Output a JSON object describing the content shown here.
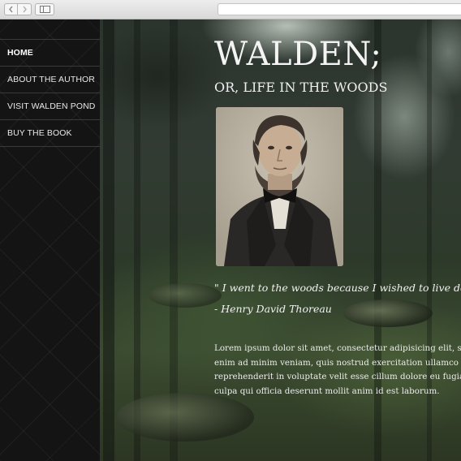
{
  "sidebar": {
    "items": [
      {
        "label": "HOME"
      },
      {
        "label": "ABOUT THE AUTHOR"
      },
      {
        "label": "VISIT WALDEN POND"
      },
      {
        "label": "BUY THE BOOK"
      }
    ]
  },
  "main": {
    "title": "WALDEN;",
    "subtitle": "OR, LIFE IN THE WOODS",
    "quote": "\" I went to the woods because I wished to live delibera",
    "attribution": "- Henry David Thoreau",
    "body_lines": [
      "Lorem ipsum dolor sit amet, consectetur adipisicing elit, sed do eius",
      "enim ad minim veniam, quis nostrud exercitation ullamco laboris nis",
      "reprehenderit in voluptate velit esse cillum dolore eu fugiat nulla par",
      "culpa qui officia deserunt mollit anim id est laborum."
    ]
  },
  "icons": {
    "back": "chevron-left-icon",
    "forward": "chevron-right-icon",
    "sidebar": "sidebar-toggle-icon"
  }
}
